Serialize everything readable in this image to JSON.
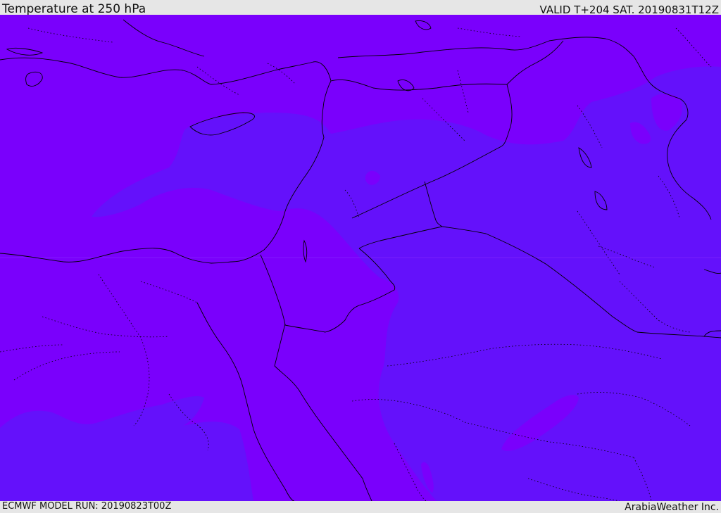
{
  "header": {
    "title": "Temperature at 250 hPa",
    "valid_time": "VALID T+204 SAT. 20190831T12Z"
  },
  "footer": {
    "model_run": "ECMWF MODEL RUN: 20190823T00Z",
    "credit": "ArabiaWeather Inc."
  },
  "map": {
    "colors": {
      "warm_band": "#7a00fc",
      "cool_band": "#6411fb",
      "border_line": "#000000"
    }
  }
}
